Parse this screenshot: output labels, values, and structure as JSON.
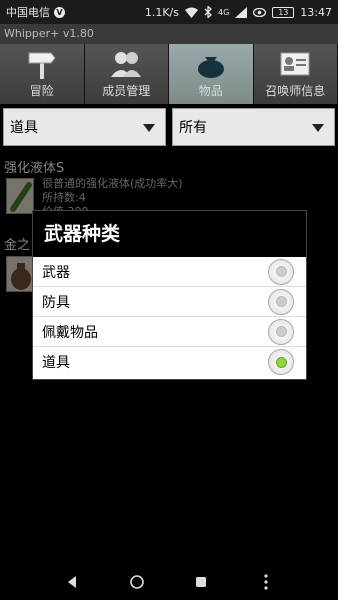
{
  "status": {
    "carrier": "中国电信",
    "carrier_badge": "V",
    "speed": "1.1K/s",
    "signal_text": "4G",
    "battery": "13",
    "time": "13:47"
  },
  "app": {
    "title": "Whipper+  v1.80"
  },
  "tabs": [
    {
      "label": "冒险",
      "icon": "signpost-icon"
    },
    {
      "label": "成员管理",
      "icon": "members-icon"
    },
    {
      "label": "物品",
      "icon": "bag-icon",
      "active": true
    },
    {
      "label": "召唤师信息",
      "icon": "id-card-icon"
    }
  ],
  "filters": {
    "category": "道具",
    "scope": "所有"
  },
  "items": [
    {
      "name": "强化液体S",
      "desc_line1": "很普通的强化液体(成功率大)",
      "desc_line2": "所持数:4",
      "desc_line3": "价值 300"
    },
    {
      "name": "金之"
    }
  ],
  "dialog": {
    "title": "武器种类",
    "options": [
      {
        "label": "武器",
        "checked": false
      },
      {
        "label": "防具",
        "checked": false
      },
      {
        "label": "佩戴物品",
        "checked": false
      },
      {
        "label": "道具",
        "checked": true
      }
    ]
  },
  "colors": {
    "radio_checked": "#8ed43a",
    "active_tab": "#7d8a8a"
  }
}
